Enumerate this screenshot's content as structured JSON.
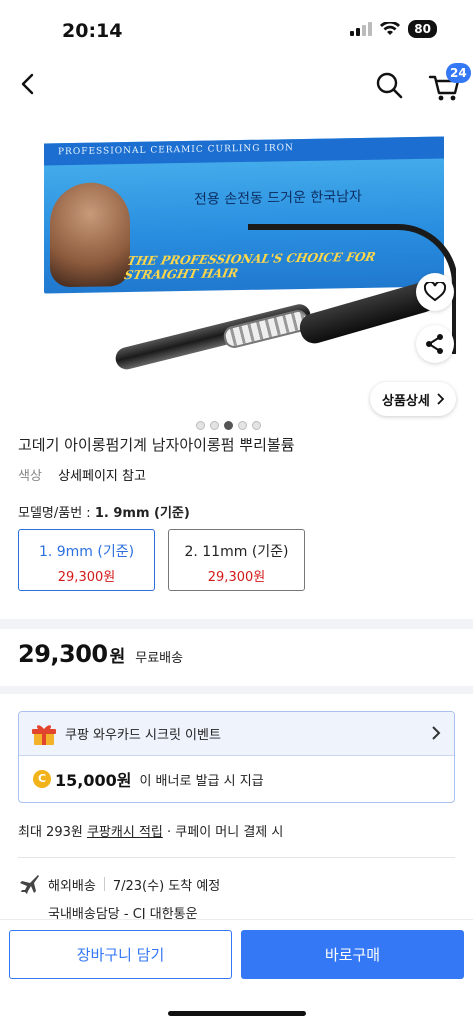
{
  "status_bar": {
    "time": "20:14",
    "battery": "80"
  },
  "nav": {
    "cart_count": "24"
  },
  "product_image": {
    "box_header": "PROFESSIONAL CERAMIC CURLING IRON",
    "box_korean": "전용 손전동 드거운 한국남자",
    "box_slogan": "THE PROFESSIONAL'S CHOICE FOR STRAIGHT HAIR",
    "detail_button": "상품상세",
    "page_count": 5,
    "active_page": 3
  },
  "product": {
    "title": "고데기 아이롱펌기계 남자아이롱펌 뿌리볼륨",
    "color_label": "색상",
    "color_value": "상세페이지 참고",
    "model_label": "모델명/품번 :",
    "model_value": "1. 9mm (기준)"
  },
  "options": [
    {
      "name": "1. 9mm (기준)",
      "price": "29,300원",
      "selected": true
    },
    {
      "name": "2. 11mm (기준)",
      "price": "29,300원",
      "selected": false
    }
  ],
  "price": {
    "amount": "29,300",
    "unit": "원",
    "shipping": "무료배송"
  },
  "promo_card": {
    "title": "쿠팡 와우카드 시크릿 이벤트",
    "coin_symbol": "C",
    "cash_amount": "15,000원",
    "cash_note": "이 배너로 발급 시 지급"
  },
  "reward": {
    "prefix": "최대 293원",
    "link": "쿠팡캐시 적립",
    "suffix": "· 쿠페이 머니 결제 시"
  },
  "shipping": {
    "type": "해외배송",
    "eta": "7/23(수) 도착 예정",
    "courier": "국내배송담당 - CJ 대한통운"
  },
  "bottom_bar": {
    "cart_button": "장바구니 담기",
    "buy_button": "바로구매"
  },
  "colors": {
    "accent": "#3478f6",
    "price_red": "#d41a1a",
    "coin": "#f2b31a"
  }
}
